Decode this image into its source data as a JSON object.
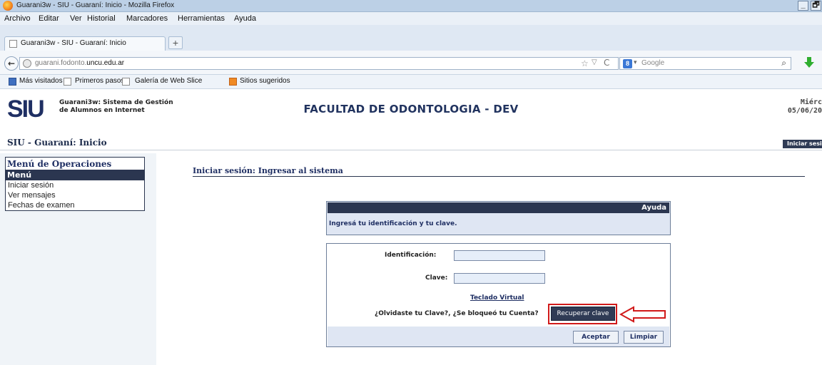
{
  "browser": {
    "window_title": "Guarani3w - SIU - Guaraní: Inicio - Mozilla Firefox",
    "window_controls": [
      "_",
      "🗗"
    ],
    "menu": [
      "Archivo",
      "Editar",
      "Ver",
      "Historial",
      "Marcadores",
      "Herramientas",
      "Ayuda"
    ],
    "tab_title": "Guarani3w - SIU - Guaraní: Inicio",
    "new_tab": "+",
    "url_host_prefix": "guarani.fodonto.",
    "url_host_main": "uncu.edu.ar",
    "search_placeholder": "Google",
    "search_engine_badge": "8",
    "bookmarks": [
      "Más visitados",
      "Primeros pasos",
      "Galería de Web Slice",
      "Sitios sugeridos"
    ]
  },
  "header": {
    "logo": "SIU",
    "app_name_line1": "Guarani3w: Sistema de Gestión",
    "app_name_line2": "de Alumnos en Internet",
    "faculty": "FACULTAD DE ODONTOLOGIA - DEV",
    "date_line1": "Miérc",
    "date_line2": "05/06/20",
    "page_title": "SIU - Guaraní: Inicio",
    "login_button": "Iniciar sesi"
  },
  "sidebar": {
    "title": "Menú de Operaciones",
    "section": "Menú",
    "items": [
      "Iniciar sesión",
      "Ver mensajes",
      "Fechas de examen"
    ]
  },
  "main": {
    "section_title": "Iniciar sesión: Ingresar al sistema",
    "help_header": "Ayuda",
    "help_text": "Ingresá tu identificación y tu clave.",
    "id_label": "Identificación:",
    "id_value": "",
    "password_label": "Clave:",
    "password_value": "",
    "virtual_keyboard": "Teclado Virtual",
    "forgot_text": "¿Olvidaste tu Clave?, ¿Se bloqueó tu Cuenta?",
    "recover_button": "Recuperar clave",
    "accept_button": "Aceptar",
    "clear_button": "Limpiar"
  },
  "colors": {
    "accent_dark": "#2b3650",
    "annotation_red": "#d11a1a"
  }
}
